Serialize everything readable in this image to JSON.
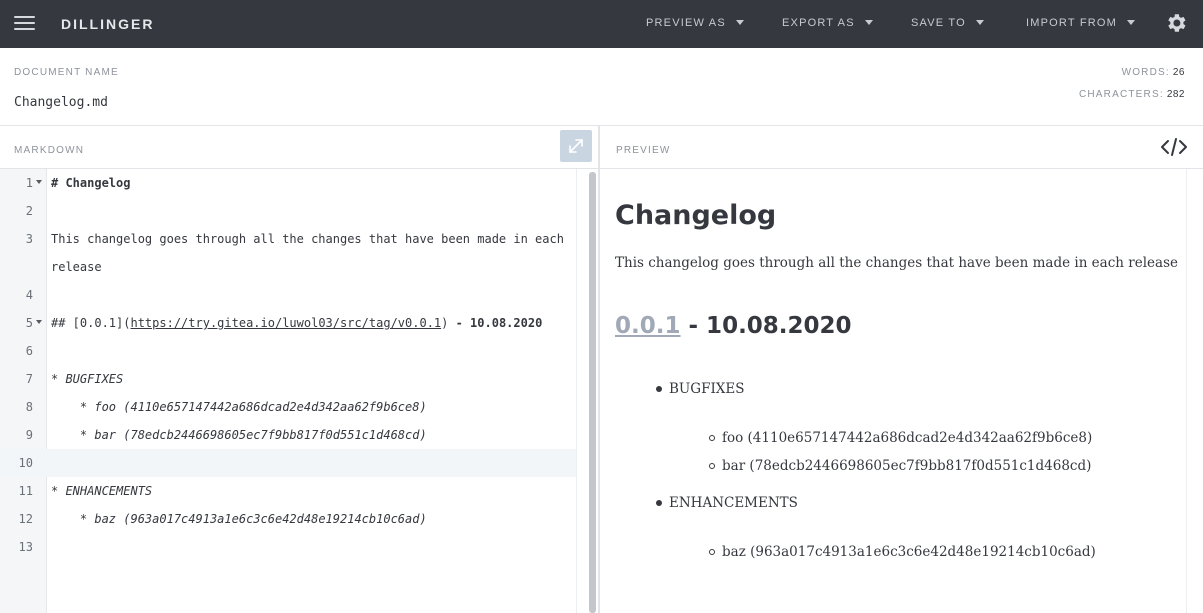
{
  "app": {
    "brand": "DILLINGER",
    "menu": [
      {
        "label": "PREVIEW AS"
      },
      {
        "label": "EXPORT AS"
      },
      {
        "label": "SAVE TO"
      },
      {
        "label": "IMPORT FROM"
      }
    ]
  },
  "document": {
    "name_label": "DOCUMENT NAME",
    "name": "Changelog.md",
    "words_label": "WORDS:",
    "words": "26",
    "chars_label": "CHARACTERS:",
    "chars": "282"
  },
  "editor": {
    "label": "MARKDOWN",
    "lines": [
      {
        "n": "1",
        "fold": true,
        "parts": [
          {
            "t": "# ",
            "s": "b"
          },
          {
            "t": "Changelog",
            "s": "b"
          }
        ]
      },
      {
        "n": "2",
        "parts": []
      },
      {
        "n": "3",
        "parts": [
          {
            "t": "This changelog goes through all the changes that have been made in each"
          }
        ]
      },
      {
        "n": "",
        "parts": [
          {
            "t": "release"
          }
        ]
      },
      {
        "n": "4",
        "parts": []
      },
      {
        "n": "5",
        "fold": true,
        "parts": [
          {
            "t": "## [0.0.1](",
            "s": ""
          },
          {
            "t": "https://try.gitea.io/luwol03/src/tag/v0.0.1",
            "s": "u"
          },
          {
            "t": ") "
          },
          {
            "t": "- 10.08.2020",
            "s": "b"
          }
        ]
      },
      {
        "n": "6",
        "parts": []
      },
      {
        "n": "7",
        "parts": [
          {
            "t": "* "
          },
          {
            "t": "BUGFIXES",
            "s": "i"
          }
        ]
      },
      {
        "n": "8",
        "parts": [
          {
            "t": "    * "
          },
          {
            "t": "foo (4110e657147442a686dcad2e4d342aa62f9b6ce8)",
            "s": "i"
          }
        ]
      },
      {
        "n": "9",
        "parts": [
          {
            "t": "    * "
          },
          {
            "t": "bar (78edcb2446698605ec7f9bb817f0d551c1d468cd)",
            "s": "i"
          }
        ]
      },
      {
        "n": "10",
        "active": true,
        "parts": []
      },
      {
        "n": "11",
        "parts": [
          {
            "t": "* "
          },
          {
            "t": "ENHANCEMENTS",
            "s": "i"
          }
        ]
      },
      {
        "n": "12",
        "parts": [
          {
            "t": "    * "
          },
          {
            "t": "baz (963a017c4913a1e6c3c6e42d48e19214cb10c6ad)",
            "s": "i"
          }
        ]
      },
      {
        "n": "13",
        "parts": []
      }
    ]
  },
  "preview": {
    "label": "PREVIEW",
    "h1": "Changelog",
    "intro": "This changelog goes through all the changes that have been made in each release",
    "h2_link": "0.0.1",
    "h2_rest": " - 10.08.2020",
    "sections": [
      {
        "title": "BUGFIXES",
        "items": [
          "foo (4110e657147442a686dcad2e4d342aa62f9b6ce8)",
          "bar (78edcb2446698605ec7f9bb817f0d551c1d468cd)"
        ]
      },
      {
        "title": "ENHANCEMENTS",
        "items": [
          "baz (963a017c4913a1e6c3c6e42d48e19214cb10c6ad)"
        ]
      }
    ]
  }
}
